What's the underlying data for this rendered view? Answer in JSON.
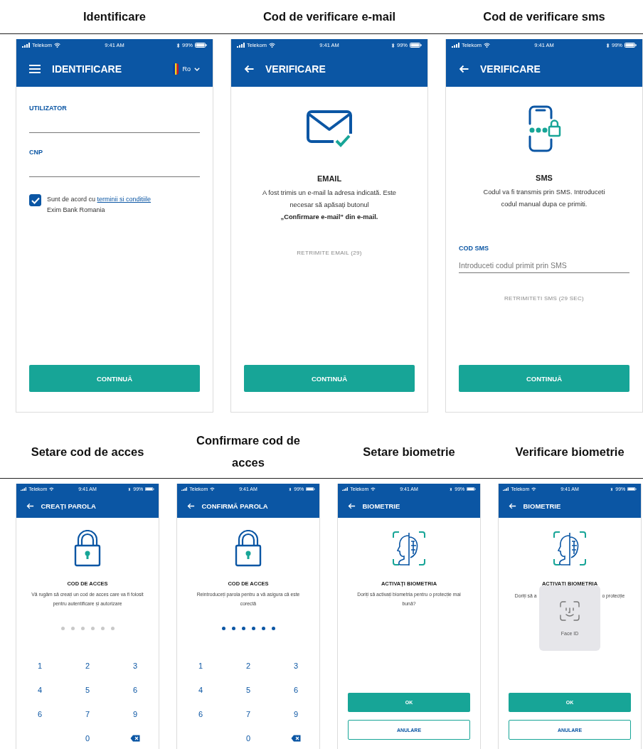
{
  "rows": [
    {
      "screens": [
        {
          "kind": "identification",
          "caption": "Identificare",
          "status_bar": {
            "carrier": "Telekom",
            "time": "9:41 AM",
            "battery": "99%"
          },
          "header": {
            "nav_icon": {
              "kind": "menu"
            },
            "title": "IDENTIFICARE",
            "language": "Ro"
          },
          "fields": [
            {
              "label": "UTILIZATOR"
            },
            {
              "label": "CNP"
            }
          ],
          "consent": {
            "checked": true,
            "text": "Sunt de acord cu",
            "link": "terminii si conditiile",
            "text_after": "Exim Bank Romania"
          },
          "button": "CONTINUĂ"
        },
        {
          "kind": "email",
          "caption": "Cod de verificare e-mail",
          "status_bar": {
            "carrier": "Telekom",
            "time": "9:41 AM",
            "battery": "99%"
          },
          "header": {
            "nav_icon": {
              "kind": "back"
            },
            "title": "VERIFICARE"
          },
          "heading": "EMAIL",
          "message": "A fost trimis un e-mail la adresa indicată. Este necesar să apăsați butonul **„Confirmare e-mail” din e-mail.**",
          "resend": "RETRIMITE EMAIL (29)",
          "button": "CONTINUĂ"
        },
        {
          "kind": "sms",
          "caption": "Cod de verificare sms",
          "status_bar": {
            "carrier": "Telekom",
            "time": "9:41 AM",
            "battery": "99%"
          },
          "header": {
            "nav_icon": {
              "kind": "back"
            },
            "title": "VERIFICARE"
          },
          "heading": "SMS",
          "message": "Codul va fi transmis prin SMS. Introduceti codul manual dupa ce primiti.",
          "field": {
            "label": "COD SMS",
            "placeholder": "Introduceti codul primit prin SMS"
          },
          "resend": "RETRIMITETI SMS (29 SEC)",
          "button": "CONTINUĂ"
        }
      ]
    },
    {
      "screens": [
        {
          "kind": "pin",
          "caption": "Setare cod de acces",
          "status_bar": {
            "carrier": "Telekom",
            "time": "9:41 AM",
            "battery": "99%"
          },
          "header": {
            "nav_icon": {
              "kind": "back"
            },
            "title": "CREAȚI PAROLA"
          },
          "heading": "COD DE ACCES",
          "message": "Vă rugăm să creați un cod de acces care va fi folosit pentru autentificare și autorizare",
          "pin_dots": [
            {
              "filled": false
            },
            {
              "filled": false
            },
            {
              "filled": false
            },
            {
              "filled": false
            },
            {
              "filled": false
            },
            {
              "filled": false
            }
          ],
          "keys": [
            "1",
            "2",
            "3",
            "4",
            "5",
            "6",
            "6",
            "7",
            "9",
            "0"
          ]
        },
        {
          "kind": "pin",
          "caption": "Confirmare cod de acces",
          "status_bar": {
            "carrier": "Telekom",
            "time": "9:41 AM",
            "battery": "99%"
          },
          "header": {
            "nav_icon": {
              "kind": "back"
            },
            "title": "CONFIRMĂ PAROLA"
          },
          "heading": "COD DE ACCES",
          "message": "Reintroduceți parola pentru a vă asigura că este corectă",
          "pin_dots": [
            {
              "filled": true
            },
            {
              "filled": true
            },
            {
              "filled": true
            },
            {
              "filled": true
            },
            {
              "filled": true
            },
            {
              "filled": true
            }
          ],
          "keys": [
            "1",
            "2",
            "3",
            "4",
            "5",
            "6",
            "6",
            "7",
            "9",
            "0"
          ]
        },
        {
          "kind": "biometric",
          "caption": "Setare biometrie",
          "status_bar": {
            "carrier": "Telekom",
            "time": "9:41 AM",
            "battery": "99%"
          },
          "header": {
            "nav_icon": {
              "kind": "back"
            },
            "title": "BIOMETRIE"
          },
          "heading": "ACTIVAȚI BIOMETRIA",
          "message": "Doriți să activați biometria pentru o protecție mai bună?",
          "buttons": [
            {
              "label": "OK",
              "kind": "primary"
            },
            {
              "label": "ANULARE",
              "kind": "secondary"
            }
          ]
        },
        {
          "kind": "biometric",
          "caption": "Verificare biometrie",
          "status_bar": {
            "carrier": "Telekom",
            "time": "9:41 AM",
            "battery": "99%"
          },
          "header": {
            "nav_icon": {
              "kind": "back"
            },
            "title": "BIOMETRIE"
          },
          "heading": "ACTIVAȚI BIOMETRIA",
          "message_fragments": [
            "Doriți să a",
            "o protecție"
          ],
          "overlay": {
            "label": "Face ID"
          },
          "buttons": [
            {
              "label": "OK",
              "kind": "primary"
            },
            {
              "label": "ANULARE",
              "kind": "secondary"
            }
          ]
        }
      ]
    }
  ]
}
